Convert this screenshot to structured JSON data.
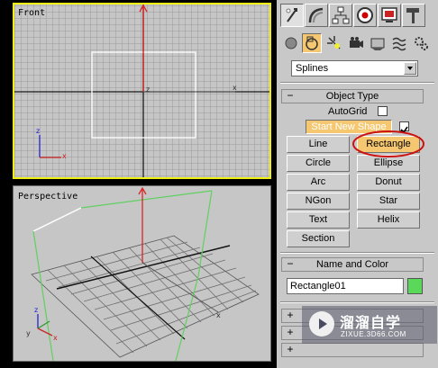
{
  "viewports": {
    "front_label": "Front",
    "perspective_label": "Perspective"
  },
  "command_panel": {
    "top_tabs": [
      "create-tab",
      "modify-tab",
      "hierarchy-tab",
      "motion-tab",
      "display-tab",
      "utilities-tab"
    ],
    "categories": [
      "geometry",
      "shapes",
      "lights",
      "cameras",
      "helpers",
      "space-warps",
      "systems"
    ],
    "dropdown_value": "Splines",
    "object_type": {
      "title": "Object Type",
      "autogrid_label": "AutoGrid",
      "start_new_shape_label": "Start New Shape",
      "buttons": [
        "Line",
        "Rectangle",
        "Circle",
        "Ellipse",
        "Arc",
        "Donut",
        "NGon",
        "Star",
        "Text",
        "Helix",
        "Section"
      ],
      "active_button": "Rectangle"
    },
    "name_and_color": {
      "title": "Name and Color",
      "name_value": "Rectangle01",
      "color": "#59d859"
    },
    "collapsed_rollouts": [
      "+",
      "+",
      "+"
    ]
  },
  "watermark": {
    "name": "溜溜自学",
    "url": "ZIXUE.3D66.COM"
  },
  "colors": {
    "active_border": "#f0f010",
    "highlight_circle": "#cc1111",
    "active_button": "#f4c770"
  }
}
